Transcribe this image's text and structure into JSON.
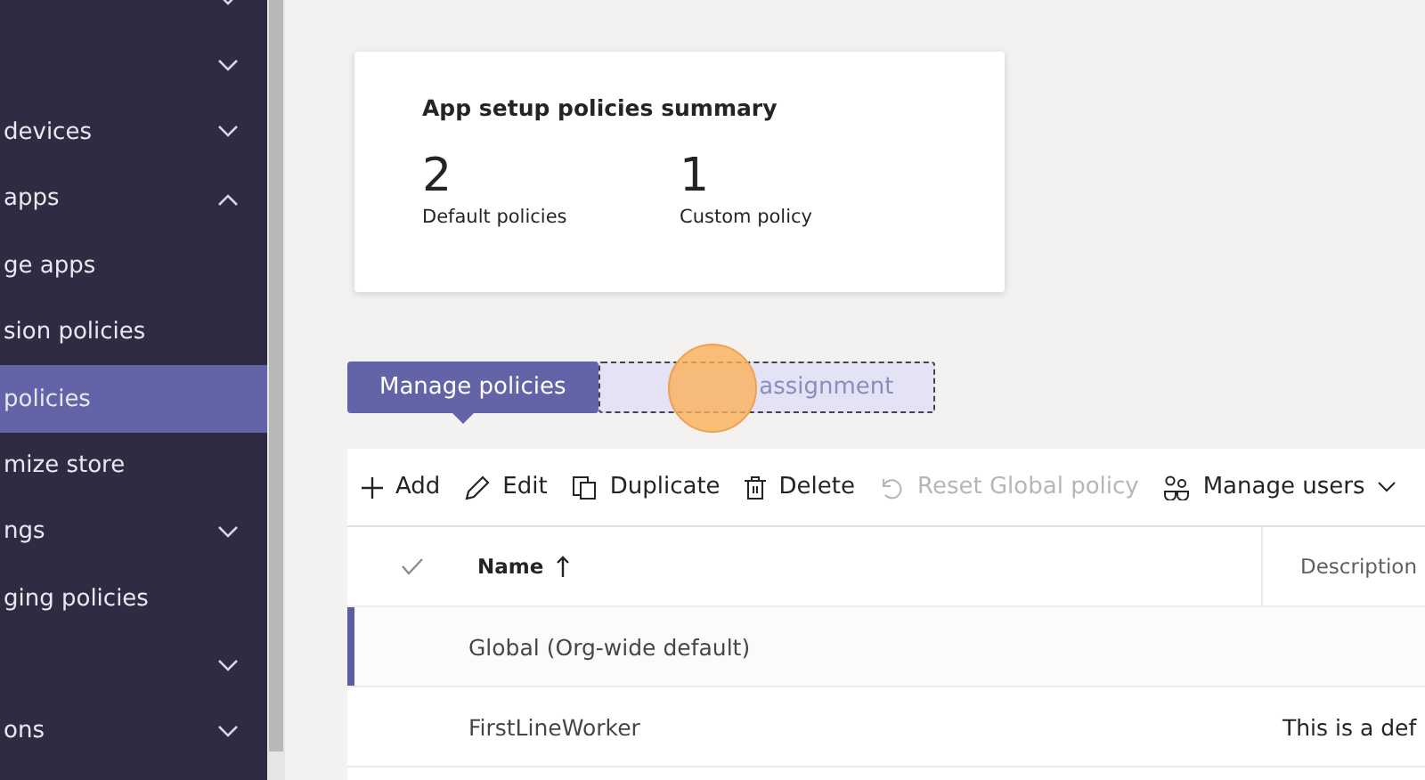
{
  "sidebar": {
    "items": [
      {
        "expanded": false,
        "selected": false
      },
      {
        "expanded": false,
        "selected": false
      },
      {
        "label": "devices",
        "expanded": false,
        "selected": false
      },
      {
        "label": "apps",
        "expanded": true,
        "selected": false
      },
      {
        "label": "ge apps",
        "selected": false
      },
      {
        "label": "sion policies",
        "selected": false
      },
      {
        "label": "policies",
        "selected": true
      },
      {
        "label": "mize store",
        "selected": false
      },
      {
        "label": "ngs",
        "expanded": false,
        "selected": false
      },
      {
        "label": "ging policies",
        "selected": false
      },
      {
        "expanded": false,
        "selected": false
      },
      {
        "label": "ons",
        "expanded": false,
        "selected": false
      }
    ]
  },
  "summary": {
    "title": "App setup policies summary",
    "stats": [
      {
        "value": "2",
        "label": "Default policies"
      },
      {
        "value": "1",
        "label": "Custom policy"
      }
    ]
  },
  "tabs": [
    {
      "label": "Manage policies",
      "selected": true
    },
    {
      "label": "assignment",
      "selected": false
    }
  ],
  "toolbar": [
    {
      "kind": "add",
      "label": "Add",
      "disabled": false
    },
    {
      "kind": "edit",
      "label": "Edit",
      "disabled": false
    },
    {
      "kind": "duplicate",
      "label": "Duplicate",
      "disabled": false
    },
    {
      "kind": "delete",
      "label": "Delete",
      "disabled": false
    },
    {
      "kind": "reset",
      "label": "Reset Global policy",
      "disabled": true
    },
    {
      "kind": "users",
      "label": "Manage users",
      "disabled": false
    }
  ],
  "table": {
    "columns": [
      "Name",
      "Description"
    ],
    "rows": [
      {
        "name": "Global (Org-wide default)",
        "selected": true
      },
      {
        "name": "FirstLineWorker",
        "description": "This is a def",
        "selected": false
      }
    ]
  }
}
